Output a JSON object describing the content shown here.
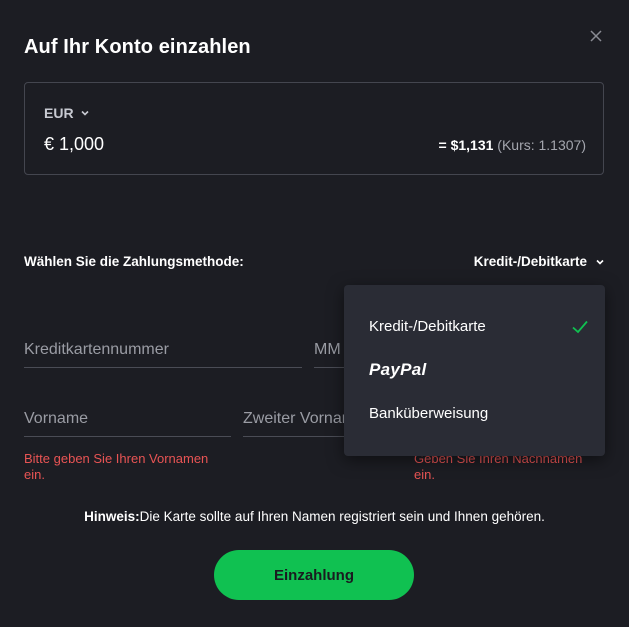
{
  "modal": {
    "title": "Auf Ihr Konto einzahlen",
    "close_icon": "close-icon"
  },
  "amount": {
    "currency": "EUR",
    "value": "€ 1,000",
    "conversion_prefix": "= $1,131",
    "conversion_rate": "(Kurs: 1.1307)"
  },
  "payment": {
    "label": "Wählen Sie die Zahlungsmethode:",
    "selected": "Kredit-/Debitkarte",
    "options": [
      {
        "label": "Kredit-/Debitkarte",
        "checked": true
      },
      {
        "label": "PayPal",
        "checked": false
      },
      {
        "label": "Banküberweisung",
        "checked": false
      }
    ]
  },
  "form": {
    "card_number_placeholder": "Kreditkartennummer",
    "month_placeholder": "MM",
    "first_name_placeholder": "Vorname",
    "middle_name_placeholder": "Zweiter Vorname",
    "first_name_error": "Bitte geben Sie Ihren Vornamen ein.",
    "last_name_error": "Geben Sie Ihren Nachnamen ein."
  },
  "notice": {
    "label": "Hinweis:",
    "text": "Die Karte sollte auf Ihren Namen registriert sein und Ihnen gehören."
  },
  "submit_label": "Einzahlung",
  "colors": {
    "background": "#1c1d23",
    "accent": "#10c151",
    "error": "#e85454",
    "dropdown_bg": "#2a2c35"
  }
}
